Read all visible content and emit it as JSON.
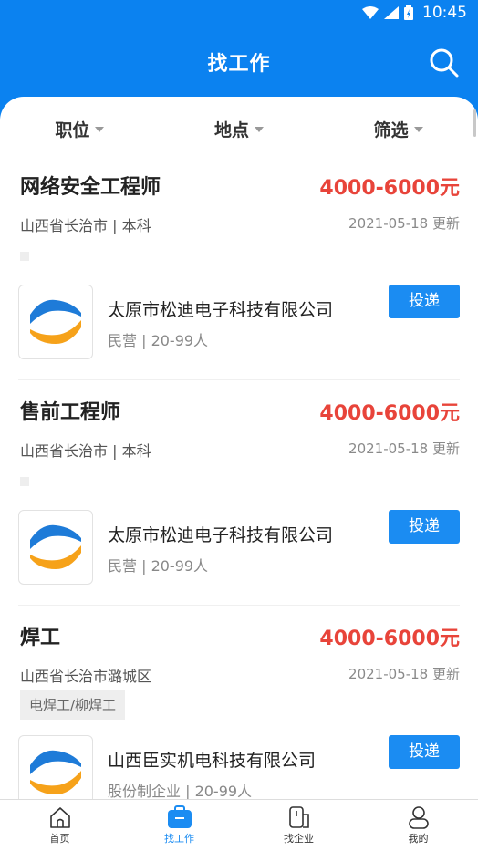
{
  "status_bar": {
    "time": "10:45"
  },
  "header": {
    "title": "找工作"
  },
  "filters": [
    "职位",
    "地点",
    "筛选"
  ],
  "jobs": [
    {
      "title": "网络安全工程师",
      "salary": "4000-6000元",
      "location": "山西省长治市 | 本科",
      "updated": "2021-05-18 更新",
      "tag": "",
      "company_name": "太原市松迪电子科技有限公司",
      "company_meta": "民营 | 20-99人",
      "apply_label": "投递"
    },
    {
      "title": "售前工程师",
      "salary": "4000-6000元",
      "location": "山西省长治市 | 本科",
      "updated": "2021-05-18 更新",
      "tag": "",
      "company_name": "太原市松迪电子科技有限公司",
      "company_meta": "民营 | 20-99人",
      "apply_label": "投递"
    },
    {
      "title": "焊工",
      "salary": "4000-6000元",
      "location": "山西省长治市潞城区",
      "updated": "2021-05-18 更新",
      "tag": "电焊工/柳焊工",
      "company_name": "山西臣实机电科技有限公司",
      "company_meta": "股份制企业 | 20-99人",
      "apply_label": "投递"
    }
  ],
  "tabbar": [
    {
      "label": "首页"
    },
    {
      "label": "找工作"
    },
    {
      "label": "找企业"
    },
    {
      "label": "我的"
    }
  ],
  "colors": {
    "brand_blue": "#0b82f0",
    "salary_red": "#e8443a",
    "button_blue": "#1b8cf2"
  }
}
